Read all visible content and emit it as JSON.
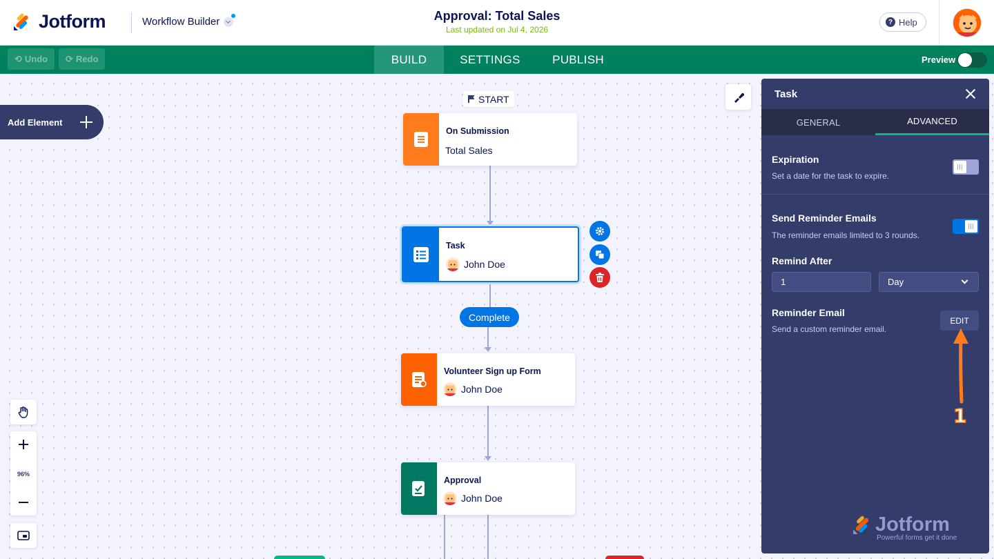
{
  "header": {
    "logo_text": "Jotform",
    "product_name": "Workflow Builder",
    "page_title": "Approval: Total Sales",
    "last_updated": "Last updated on Jul 4, 2026",
    "help_label": "Help"
  },
  "toolbar": {
    "undo_label": "Undo",
    "redo_label": "Redo",
    "tabs": [
      {
        "label": "BUILD",
        "active": true
      },
      {
        "label": "SETTINGS",
        "active": false
      },
      {
        "label": "PUBLISH",
        "active": false
      }
    ],
    "preview_label": "Preview",
    "preview_on": false
  },
  "canvas": {
    "add_element_label": "Add Element",
    "start_label": "START",
    "complete_label": "Complete",
    "zoom_level": "96%",
    "nodes": [
      {
        "title": "On Submission",
        "subtitle": "Total Sales",
        "color": "#ff7b1c"
      },
      {
        "title": "Task",
        "subtitle": "John Doe",
        "color": "#0075e3",
        "selected": true
      },
      {
        "title": "Volunteer Sign up Form",
        "subtitle": "John Doe",
        "color": "#ff6100"
      },
      {
        "title": "Approval",
        "subtitle": "John Doe",
        "color": "#007862"
      }
    ]
  },
  "panel": {
    "title": "Task",
    "tabs": [
      {
        "label": "GENERAL",
        "active": false
      },
      {
        "label": "ADVANCED",
        "active": true
      }
    ],
    "expiration": {
      "title": "Expiration",
      "description": "Set a date for the task to expire.",
      "enabled": false
    },
    "reminder_emails": {
      "title": "Send Reminder Emails",
      "description": "The reminder emails limited to 3 rounds.",
      "enabled": true
    },
    "remind_after": {
      "title": "Remind After",
      "value": "1",
      "unit": "Day"
    },
    "reminder_email": {
      "title": "Reminder Email",
      "description": "Send a custom reminder email.",
      "edit_label": "EDIT"
    },
    "logo_text": "Jotform",
    "tagline": "Powerful forms get it done"
  },
  "annotation": {
    "number": "1",
    "color": "#ff7b1c"
  }
}
